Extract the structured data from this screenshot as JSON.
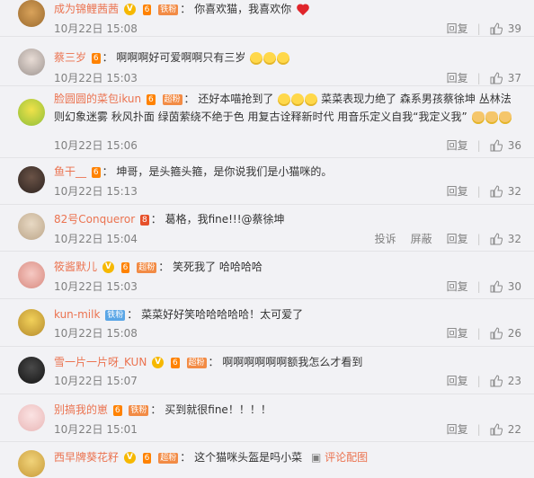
{
  "labels": {
    "reply": "回复",
    "report": "投诉",
    "block": "屏蔽",
    "reply_config": "评论配图"
  },
  "badges": {
    "iron": "铁粉",
    "super": "超粉"
  },
  "colors": {
    "username": "#eb7350",
    "time": "#808080",
    "background": "#f2f2f5"
  },
  "comments": [
    {
      "user": "成为锦鲤茜茜",
      "text": "你喜欢猫，我喜欢你",
      "time": "10月22日 15:08",
      "likes": "39"
    },
    {
      "user": "蔡三岁",
      "text": "啊啊啊好可爱啊啊只有三岁",
      "time": "10月22日 15:03",
      "likes": "37"
    },
    {
      "user": "脸圆圆的菜包ikun",
      "text": "还好本喵抢到了",
      "text2": "菜菜表现力绝了 森系男孩蔡徐坤 丛林法则幻象迷雾 秋风扑面 绿茵萦绕不绝于色 用复古诠释新时代 用音乐定义自我“我定义我”",
      "time": "10月22日 15:06",
      "likes": "36"
    },
    {
      "user": "鱼干__",
      "text": "坤哥，是头箍头箍，是你说我们是小猫咪的。",
      "time": "10月22日 15:13",
      "likes": "32"
    },
    {
      "user": "82号Conqueror",
      "text": "葛格，我fine!!!@蔡徐坤",
      "time": "10月22日 15:04",
      "likes": "32"
    },
    {
      "user": "筱酱默儿",
      "text": "笑死我了 哈哈哈哈",
      "time": "10月22日 15:03",
      "likes": "30"
    },
    {
      "user": "kun-milk",
      "text": "菜菜好好笑哈哈哈哈哈！太可爱了",
      "time": "10月22日 15:08",
      "likes": "26"
    },
    {
      "user": "雪一片一片呀_KUN",
      "text": "啊啊啊啊啊啊额我怎么才看到",
      "time": "10月22日 15:07",
      "likes": "23"
    },
    {
      "user": "别搞我的崽",
      "text": "买到就很fine！！！！",
      "time": "10月22日 15:01",
      "likes": "22"
    },
    {
      "user": "西早牌葵花籽",
      "text": "这个猫咪头盔是吗小菜"
    }
  ]
}
